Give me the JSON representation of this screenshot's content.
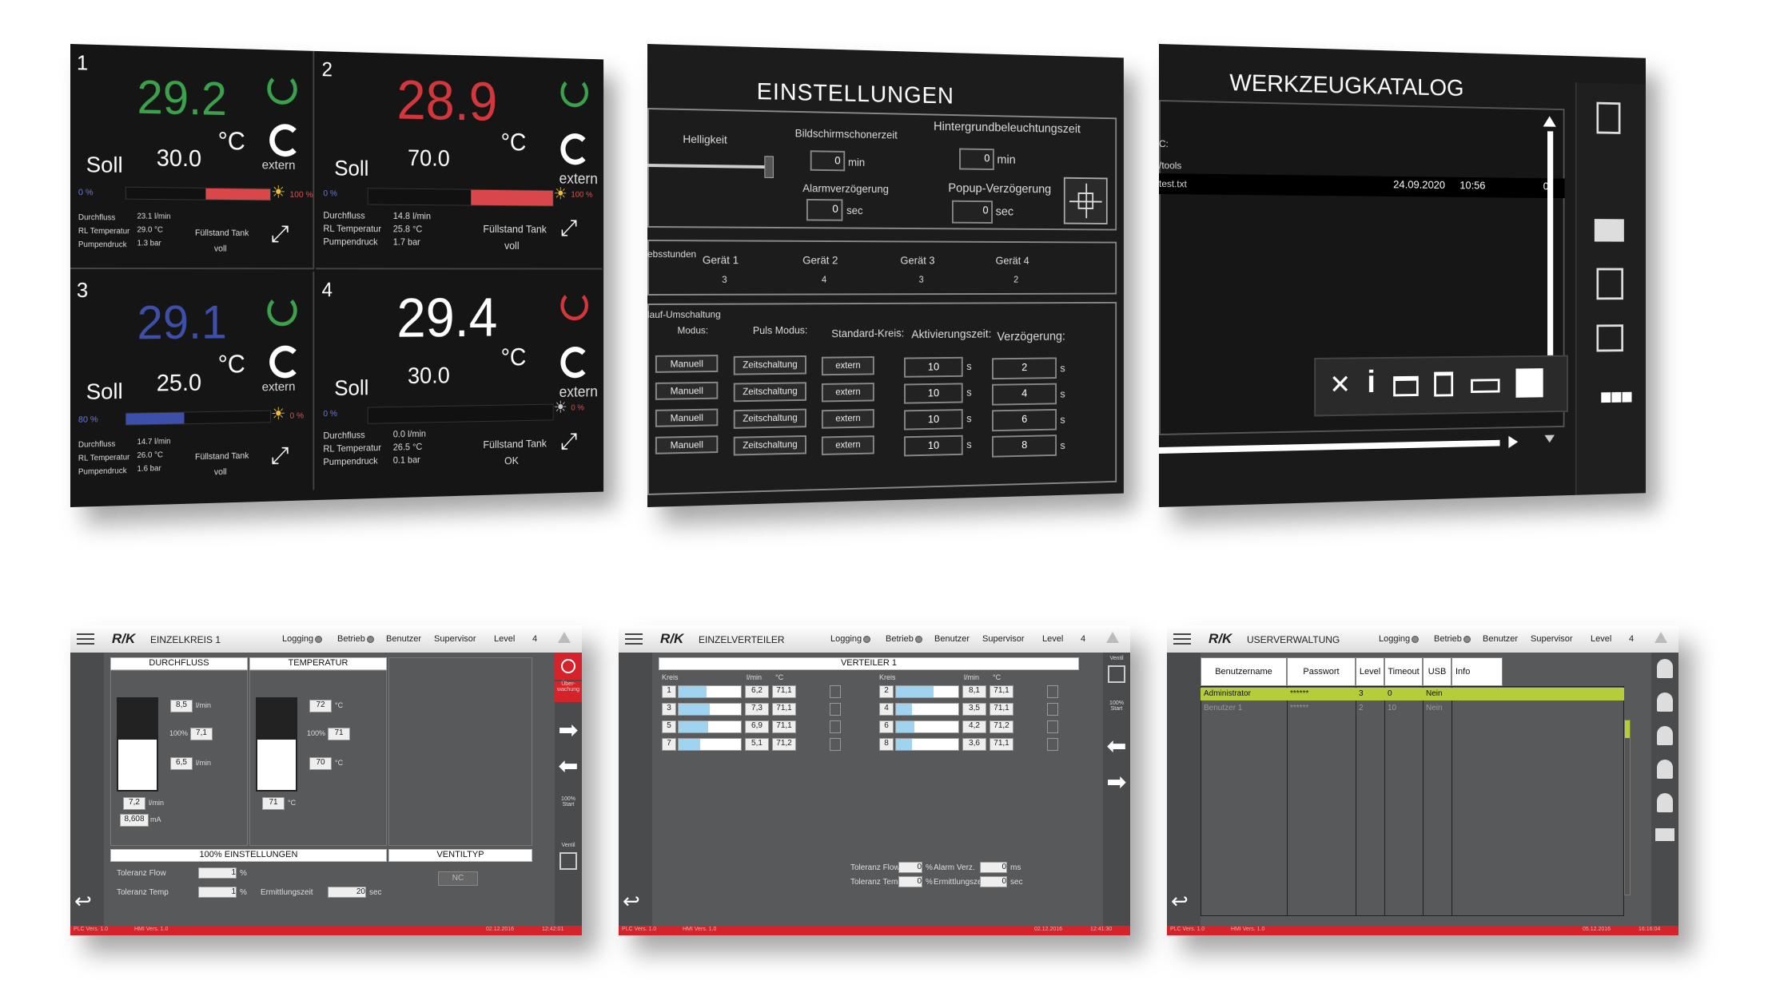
{
  "panel1": {
    "quads": [
      {
        "num": "1",
        "temp": "29.2",
        "soll_label": "Soll",
        "soll_value": "30.0",
        "unit": "°C",
        "mode": "extern",
        "pct_left": "0  %",
        "pct_right": "100  %",
        "rows": [
          [
            "Durchfluss",
            "23.1  l/min"
          ],
          [
            "RL Temperatur",
            "29.0  °C"
          ],
          [
            "Pumpendruck",
            "1.3  bar"
          ]
        ],
        "tank_label": "Füllstand Tank",
        "tank_value": "voll",
        "fill": 0.45
      },
      {
        "num": "2",
        "temp": "28.9",
        "soll_label": "Soll",
        "soll_value": "70.0",
        "unit": "°C",
        "mode": "extern",
        "pct_left": "0  %",
        "pct_right": "100  %",
        "rows": [
          [
            "Durchfluss",
            "14.8  l/min"
          ],
          [
            "RL Temperatur",
            "25.8  °C"
          ],
          [
            "Pumpendruck",
            "1.7  bar"
          ]
        ],
        "tank_label": "Füllstand Tank",
        "tank_value": "voll",
        "fill": 0.45
      },
      {
        "num": "3",
        "temp": "29.1",
        "soll_label": "Soll",
        "soll_value": "25.0",
        "unit": "°C",
        "mode": "extern",
        "pct_left": "80  %",
        "pct_right": "0  %",
        "rows": [
          [
            "Durchfluss",
            "14.7  l/min"
          ],
          [
            "RL Temperatur",
            "26.0  °C"
          ],
          [
            "Pumpendruck",
            "1.6  bar"
          ]
        ],
        "tank_label": "Füllstand Tank",
        "tank_value": "voll",
        "fill": 0.4
      },
      {
        "num": "4",
        "temp": "29.4",
        "soll_label": "Soll",
        "soll_value": "30.0",
        "unit": "°C",
        "mode": "extern",
        "pct_left": "0  %",
        "pct_right": "0  %",
        "rows": [
          [
            "Durchfluss",
            "0.0  l/min"
          ],
          [
            "RL Temperatur",
            "26.5  °C"
          ],
          [
            "Pumpendruck",
            "0.1  bar"
          ]
        ],
        "tank_label": "Füllstand Tank",
        "tank_value": "OK",
        "fill": 0
      }
    ],
    "colors": {
      "green": "#3aa24a",
      "red": "#d3373c",
      "blue": "#3d4fa8",
      "white": "#ffffff",
      "bar_red": "#d9474b"
    }
  },
  "panel2": {
    "title": "EINSTELLUNGEN",
    "helligkeit": "Helligkeit",
    "bildschirm": "Bildschirmschonerzeit",
    "bildschirm_val": "0",
    "bildschirm_unit": "min",
    "hintergrund": "Hintergrundbeleuchtungszeit",
    "hintergrund_val": "0",
    "hintergrund_unit": "min",
    "alarm": "Alarmverzögerung",
    "alarm_val": "0",
    "alarm_unit": "sec",
    "popup": "Popup-Verzögerung",
    "popup_val": "0",
    "popup_unit": "sec",
    "stunden_label": "ebsstunden",
    "geraete": [
      [
        "Gerät 1",
        "3"
      ],
      [
        "Gerät 2",
        "4"
      ],
      [
        "Gerät 3",
        "3"
      ],
      [
        "Gerät 4",
        "2"
      ]
    ],
    "umschaltung": "lauf-Umschaltung",
    "modus": "Modus:",
    "puls": "Puls Modus:",
    "standard": "Standard-Kreis:",
    "aktiv": "Aktivierungszeit:",
    "verz": "Verzögerung:",
    "rows": [
      {
        "modus": "Manuell",
        "puls": "Zeitschaltung",
        "std": "extern",
        "akt": "10",
        "verz": "2"
      },
      {
        "modus": "Manuell",
        "puls": "Zeitschaltung",
        "std": "extern",
        "akt": "10",
        "verz": "4"
      },
      {
        "modus": "Manuell",
        "puls": "Zeitschaltung",
        "std": "extern",
        "akt": "10",
        "verz": "6"
      },
      {
        "modus": "Manuell",
        "puls": "Zeitschaltung",
        "std": "extern",
        "akt": "10",
        "verz": "8"
      }
    ],
    "s": "s"
  },
  "panel3": {
    "title": "WERKZEUGKATALOG",
    "path": "C:",
    "items": [
      "/tools",
      "test.txt"
    ],
    "date": "24.09.2020",
    "time": "10:56",
    "size": "0"
  },
  "bl": {
    "title": "EINZELKREIS 1",
    "logging": "Logging",
    "betrieb": "Betrieb",
    "benutzer": "Benutzer",
    "supervisor": "Supervisor",
    "level": "Level",
    "level_val": "4",
    "durchfluss": "DURCHFLUSS",
    "temperatur": "TEMPERATUR",
    "df_hi": "8,5",
    "df_hi_unit": "l/min",
    "df_pct": "100%",
    "df_mid": "7,1",
    "df_lo": "6,5",
    "df_lo_unit": "l/min",
    "df_cur": "7,2",
    "df_cur_unit": "l/min",
    "df_ma": "8,608",
    "df_ma_unit": "mA",
    "t_hi": "72",
    "t_hi_unit": "°C",
    "t_pct": "100%",
    "t_mid": "71",
    "t_lo": "70",
    "t_lo_unit": "°C",
    "t_cur": "71",
    "t_cur_unit": "°C",
    "einst": "100% EINSTELLUNGEN",
    "ventiltyp": "VENTILTYP",
    "nc": "NC",
    "tol_flow": "Toleranz Flow",
    "tol_flow_val": "1",
    "tol_temp": "Toleranz Temp",
    "tol_temp_val": "1",
    "pct": "%",
    "ermitt": "Ermittlungszeit",
    "ermitt_val": "20",
    "sec": "sec",
    "ueber": "Über-\nwachung",
    "start100": "100%\nStart",
    "ventil": "Ventil",
    "plc": "PLC Vers. 1.0",
    "hmi": "HMI Vers. 1.0",
    "date": "02.12.2016",
    "time": "12:42:01"
  },
  "bm": {
    "title": "EINZELVERTEILER",
    "logging": "Logging",
    "betrieb": "Betrieb",
    "benutzer": "Benutzer",
    "supervisor": "Supervisor",
    "level": "Level",
    "level_val": "4",
    "verteiler": "VERTEILER 1",
    "kreis": "Kreis",
    "lmin": "l/min",
    "degc": "°C",
    "left": [
      [
        "1",
        "6,2",
        "71,1",
        0.45
      ],
      [
        "3",
        "7,3",
        "71,1",
        0.5
      ],
      [
        "5",
        "6,9",
        "71,1",
        0.48
      ],
      [
        "7",
        "5,1",
        "71,2",
        0.35
      ]
    ],
    "right": [
      [
        "2",
        "8,1",
        "71,1",
        0.6
      ],
      [
        "4",
        "3,5",
        "71,1",
        0.25
      ],
      [
        "6",
        "4,2",
        "71,2",
        0.3
      ],
      [
        "8",
        "3,6",
        "71,1",
        0.25
      ]
    ],
    "tol_flow": "Toleranz Flow",
    "tol_flow_val": "0",
    "tol_temp": "Toleranz Temp",
    "tol_temp_val": "0",
    "pct": "%",
    "alarm": "Alarm Verz.",
    "alarm_val": "0",
    "ms": "ms",
    "ermitt": "Ermittlungszeit",
    "ermitt_val": "0",
    "sec": "sec",
    "ventil": "Ventil",
    "start100": "100%\nStart",
    "plc": "PLC Vers. 1.0",
    "hmi": "HMI Vers. 1.0",
    "date": "02.12.2016",
    "time": "12:41:30"
  },
  "br": {
    "title": "USERVERWALTUNG",
    "logging": "Logging",
    "betrieb": "Betrieb",
    "benutzer": "Benutzer",
    "supervisor": "Supervisor",
    "level": "Level",
    "level_val": "4",
    "cols": [
      "Benutzername",
      "Passwort",
      "Level",
      "Timeout",
      "USB",
      "Info"
    ],
    "rows": [
      [
        "Administrator",
        "******",
        "3",
        "0",
        "Nein",
        ""
      ],
      [
        "Benutzer 1",
        "******",
        "2",
        "10",
        "Nein",
        ""
      ]
    ],
    "plc": "PLC Vers. 1.0",
    "hmi": "HMI Vers. 1.0",
    "date": "05.12.2016",
    "time": "16:16:04"
  },
  "logo": "R/K"
}
